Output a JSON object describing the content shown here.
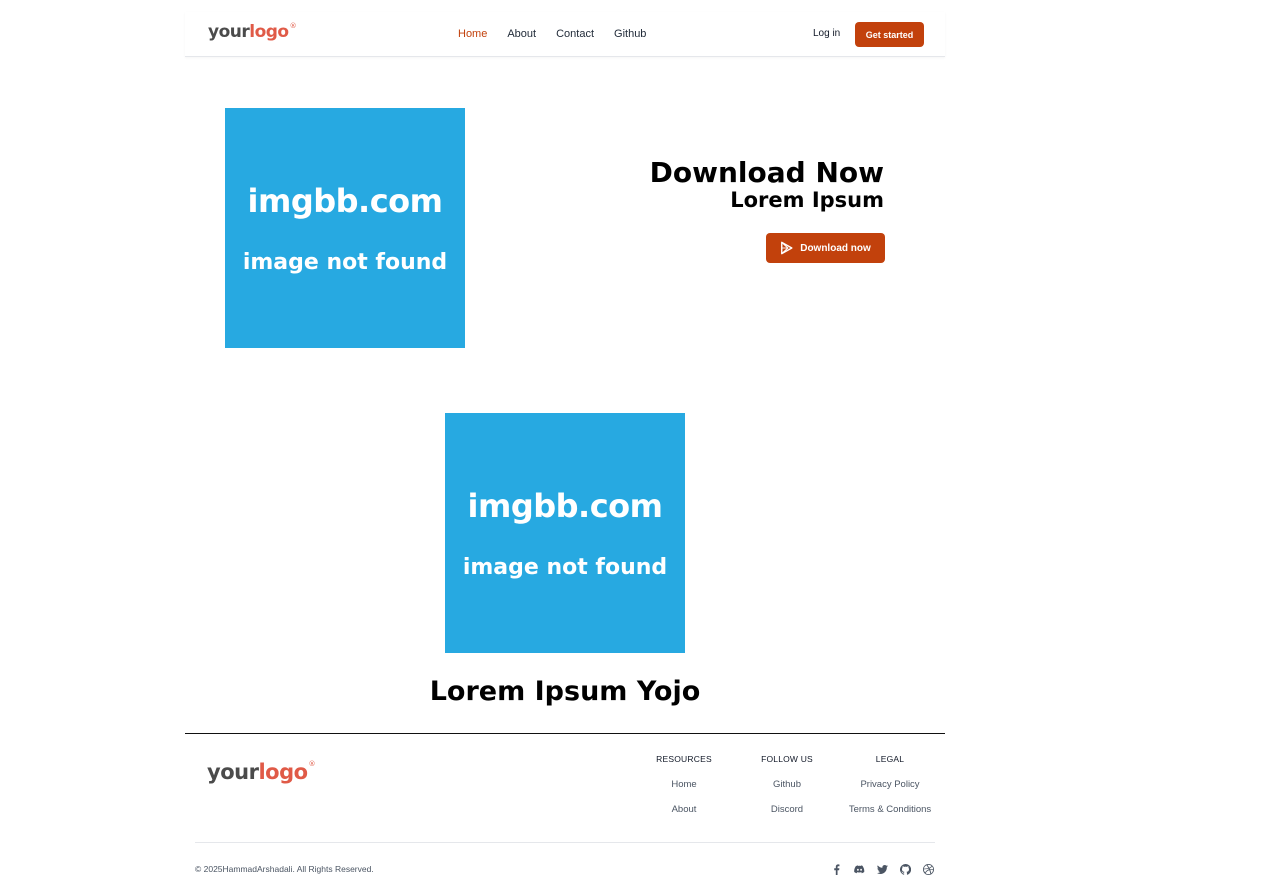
{
  "nav": {
    "logo_word1": "your",
    "logo_word2": "logo",
    "logo_reg": "®",
    "links": [
      "Home",
      "About",
      "Contact",
      "Github"
    ],
    "active_link": "Home",
    "login": "Log in",
    "cta": "Get started"
  },
  "hero": {
    "image_text1": "imgbb.com",
    "image_text2": "image not found",
    "title": "Download Now",
    "subtitle": "Lorem Ipsum",
    "button": "Download now",
    "button_icon": "play-store-icon"
  },
  "section": {
    "image_text1": "imgbb.com",
    "image_text2": "image not found",
    "title": "Lorem Ipsum Yojo"
  },
  "footer": {
    "logo_word1": "your",
    "logo_word2": "logo",
    "logo_reg": "®",
    "columns": [
      {
        "heading": "RESOURCES",
        "links": [
          "Home",
          "About"
        ]
      },
      {
        "heading": "FOLLOW US",
        "links": [
          "Github",
          "Discord"
        ]
      },
      {
        "heading": "LEGAL",
        "links": [
          "Privacy Policy",
          "Terms & Conditions"
        ]
      }
    ],
    "copyright": "© 2025HammadArshadali. All Rights Reserved.",
    "social_icons": [
      "facebook-icon",
      "discord-icon",
      "twitter-icon",
      "github-icon",
      "dribbble-icon"
    ]
  },
  "colors": {
    "accent": "#c2410c",
    "logo_accent": "#e05a47",
    "placeholder_bg": "#27a9e1"
  }
}
